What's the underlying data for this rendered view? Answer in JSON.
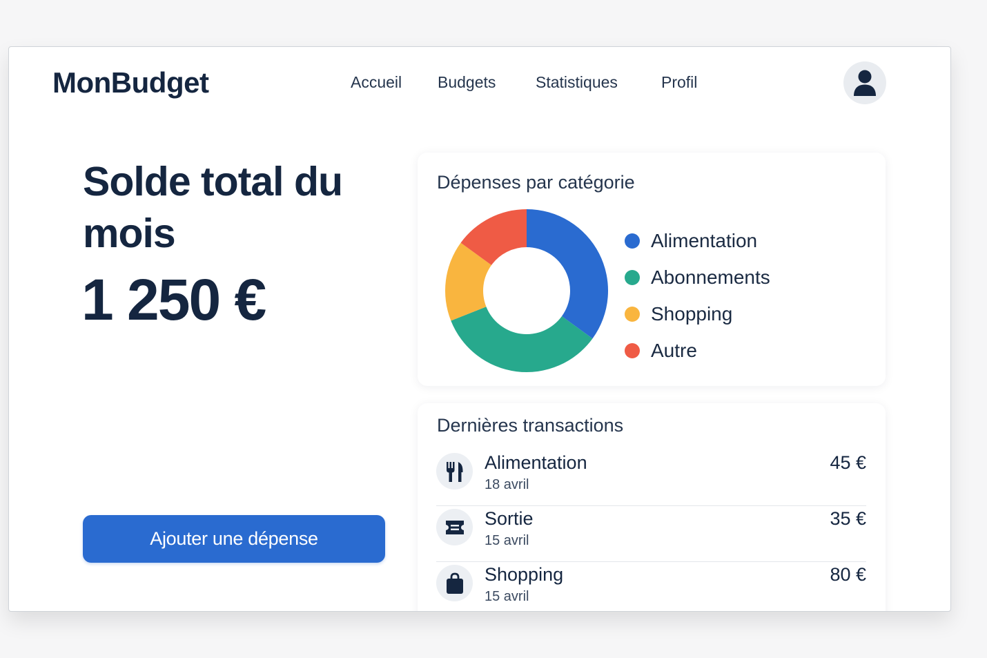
{
  "app": {
    "logo": "MonBudget"
  },
  "nav": {
    "items": [
      {
        "label": "Accueil"
      },
      {
        "label": "Budgets"
      },
      {
        "label": "Statistiques"
      },
      {
        "label": "Profil"
      }
    ],
    "avatar_icon": "user-icon"
  },
  "balance": {
    "title": "Solde total du mois",
    "amount": "1 250 €"
  },
  "actions": {
    "add_expense_label": "Ajouter une dépense"
  },
  "expenses_card": {
    "title": "Dépenses par catégorie"
  },
  "chart_data": {
    "type": "pie",
    "donut": true,
    "categories": [
      "Alimentation",
      "Abonnements",
      "Shopping",
      "Autre"
    ],
    "values": [
      35,
      34,
      16,
      15
    ],
    "colors": [
      "#2a6bd0",
      "#27a98d",
      "#f9b53f",
      "#ef5b45"
    ],
    "legend_position": "right"
  },
  "transactions_card": {
    "title": "Dernières transactions",
    "items": [
      {
        "name": "Alimentation",
        "date": "18 avril",
        "amount": "45 €",
        "icon": "fork-knife-icon"
      },
      {
        "name": "Sortie",
        "date": "15 avril",
        "amount": "35 €",
        "icon": "ticket-icon"
      },
      {
        "name": "Shopping",
        "date": "15 avril",
        "amount": "80 €",
        "icon": "shopping-bag-icon"
      }
    ]
  },
  "colors": {
    "primary": "#2a6bd0",
    "text_dark": "#152640",
    "background": "#f6f6f7"
  }
}
